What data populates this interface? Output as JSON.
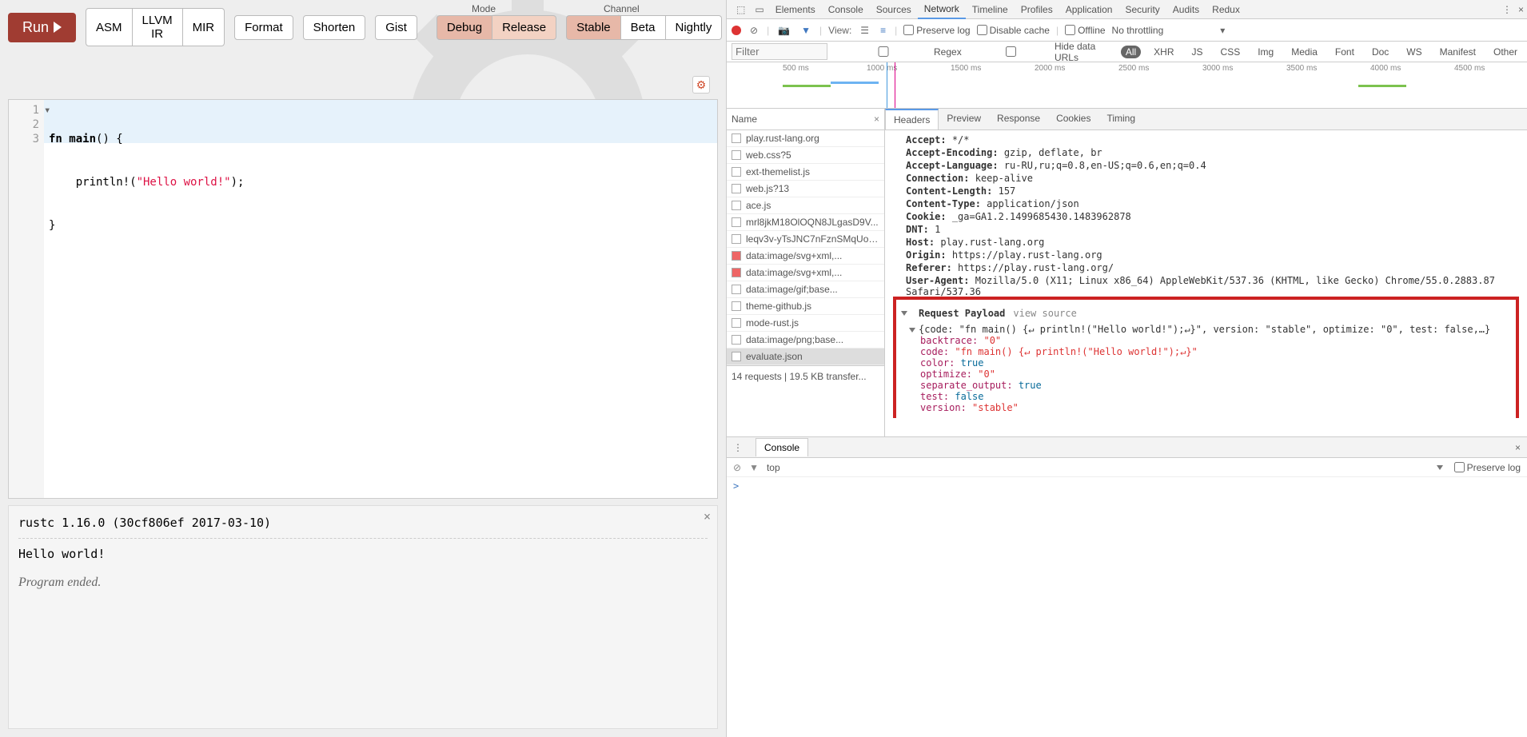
{
  "playground": {
    "run": "Run",
    "buttons": {
      "asm": "ASM",
      "llvmir": "LLVM IR",
      "mir": "MIR",
      "format": "Format",
      "shorten": "Shorten",
      "gist": "Gist"
    },
    "mode_label": "Mode",
    "channel_label": "Channel",
    "modes": {
      "debug": "Debug",
      "release": "Release"
    },
    "channels": {
      "stable": "Stable",
      "beta": "Beta",
      "nightly": "Nightly"
    },
    "code": {
      "l1_a": "fn ",
      "l1_b": "main",
      "l1_c": "() {",
      "l2_a": "    println!(",
      "l2_b": "\"Hello world!\"",
      "l2_c": ");",
      "l3": "}"
    },
    "output": {
      "rustc": "rustc 1.16.0 (30cf806ef 2017-03-10)",
      "hello": "Hello world!",
      "ended": "Program ended."
    }
  },
  "devtools": {
    "tabs": [
      "Elements",
      "Console",
      "Sources",
      "Network",
      "Timeline",
      "Profiles",
      "Application",
      "Security",
      "Audits",
      "Redux"
    ],
    "active_tab": "Network",
    "toolbar": {
      "view": "View:",
      "preserve": "Preserve log",
      "disable": "Disable cache",
      "offline": "Offline",
      "throttle": "No throttling"
    },
    "filter": {
      "placeholder": "Filter",
      "regex": "Regex",
      "hide": "Hide data URLs",
      "types": [
        "All",
        "XHR",
        "JS",
        "CSS",
        "Img",
        "Media",
        "Font",
        "Doc",
        "WS",
        "Manifest",
        "Other"
      ]
    },
    "timeline": {
      "marks": [
        "500 ms",
        "1000 ms",
        "1500 ms",
        "2000 ms",
        "2500 ms",
        "3000 ms",
        "3500 ms",
        "4000 ms",
        "4500 ms"
      ]
    },
    "name_hdr": "Name",
    "requests": [
      "play.rust-lang.org",
      "web.css?5",
      "ext-themelist.js",
      "web.js?13",
      "ace.js",
      "mrl8jkM18OlOQN8JLgasD9V...",
      "leqv3v-yTsJNC7nFznSMqUo0...",
      "data:image/svg+xml,...",
      "data:image/svg+xml,...",
      "data:image/gif;base...",
      "theme-github.js",
      "mode-rust.js",
      "data:image/png;base...",
      "evaluate.json"
    ],
    "summary": "14 requests   |   19.5 KB transfer...",
    "detail_tabs": [
      "Headers",
      "Preview",
      "Response",
      "Cookies",
      "Timing"
    ],
    "headers": {
      "accept_k": "Accept:",
      "accept_v": "*/*",
      "ae_k": "Accept-Encoding:",
      "ae_v": "gzip, deflate, br",
      "al_k": "Accept-Language:",
      "al_v": "ru-RU,ru;q=0.8,en-US;q=0.6,en;q=0.4",
      "conn_k": "Connection:",
      "conn_v": "keep-alive",
      "cl_k": "Content-Length:",
      "cl_v": "157",
      "ct_k": "Content-Type:",
      "ct_v": "application/json",
      "cookie_k": "Cookie:",
      "cookie_v": "_ga=GA1.2.1499685430.1483962878",
      "dnt_k": "DNT:",
      "dnt_v": "1",
      "host_k": "Host:",
      "host_v": "play.rust-lang.org",
      "origin_k": "Origin:",
      "origin_v": "https://play.rust-lang.org",
      "referer_k": "Referer:",
      "referer_v": "https://play.rust-lang.org/",
      "ua_k": "User-Agent:",
      "ua_v": "Mozilla/5.0 (X11; Linux x86_64) AppleWebKit/537.36 (KHTML, like Gecko) Chrome/55.0.2883.87 Safari/537.36"
    },
    "payload": {
      "title": "Request Payload",
      "view_source": "view source",
      "obj": "{code: \"fn main() {↵ println!(\"Hello world!\");↵}\", version: \"stable\", optimize: \"0\", test: false,…}",
      "backtrace_k": "backtrace:",
      "backtrace_v": "\"0\"",
      "code_k": "code:",
      "code_v": "\"fn main() {↵    println!(\"Hello world!\");↵}\"",
      "color_k": "color:",
      "color_v": "true",
      "optimize_k": "optimize:",
      "optimize_v": "\"0\"",
      "sep_k": "separate_output:",
      "sep_v": "true",
      "test_k": "test:",
      "test_v": "false",
      "version_k": "version:",
      "version_v": "\"stable\""
    },
    "console": {
      "tab": "Console",
      "top": "top",
      "preserve": "Preserve log",
      "prompt": ">"
    }
  }
}
